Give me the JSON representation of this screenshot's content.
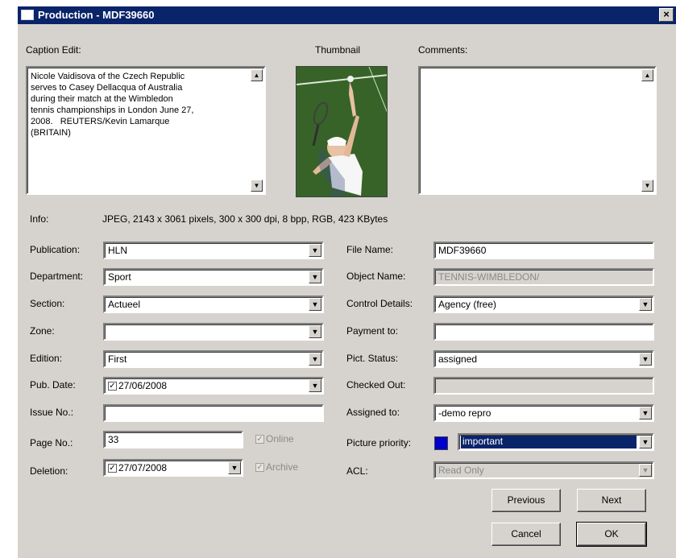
{
  "window": {
    "title": "Production - MDF39660",
    "close_glyph": "×"
  },
  "caption": {
    "label": "Caption Edit:",
    "text": "Nicole Vaidisova of the Czech Republic\nserves to Casey Dellacqua of Australia\nduring their match at the Wimbledon\ntennis championships in London June 27,\n2008.   REUTERS/Kevin Lamarque\n(BRITAIN)"
  },
  "thumbnail": {
    "label": "Thumbnail"
  },
  "comments": {
    "label": "Comments:",
    "text": ""
  },
  "info": {
    "label": "Info:",
    "value": "JPEG, 2143 x 3061 pixels, 300 x 300 dpi, 8 bpp, RGB, 423 KBytes"
  },
  "left_fields": {
    "publication": {
      "label": "Publication:",
      "value": "HLN"
    },
    "department": {
      "label": "Department:",
      "value": "Sport"
    },
    "section": {
      "label": "Section:",
      "value": "Actueel"
    },
    "zone": {
      "label": "Zone:",
      "value": ""
    },
    "edition": {
      "label": "Edition:",
      "value": "First"
    },
    "pub_date": {
      "label": "Pub. Date:",
      "value": "27/06/2008",
      "checked": "✓"
    },
    "issue_no": {
      "label": "Issue No.:",
      "value": ""
    },
    "page_no": {
      "label": "Page No.:",
      "value": "33"
    },
    "deletion": {
      "label": "Deletion:",
      "value": "27/07/2008",
      "checked": "✓"
    },
    "online": {
      "label": "Online",
      "checked": "✓"
    },
    "archive": {
      "label": "Archive",
      "checked": "✓"
    }
  },
  "right_fields": {
    "file_name": {
      "label": "File Name:",
      "value": "MDF39660"
    },
    "object_name": {
      "label": "Object Name:",
      "value": "TENNIS-WIMBLEDON/"
    },
    "control_details": {
      "label": "Control Details:",
      "value": "Agency (free)"
    },
    "payment_to": {
      "label": "Payment to:",
      "value": ""
    },
    "pict_status": {
      "label": "Pict. Status:",
      "value": "assigned"
    },
    "checked_out": {
      "label": "Checked Out:",
      "value": ""
    },
    "assigned_to": {
      "label": "Assigned to:",
      "value": "-demo repro"
    },
    "picture_priority": {
      "label": "Picture priority:",
      "value": "important",
      "color": "#0000cc"
    },
    "acl": {
      "label": "ACL:",
      "value": "Read Only"
    }
  },
  "buttons": {
    "previous": "Previous",
    "next": "Next",
    "cancel": "Cancel",
    "ok": "OK"
  },
  "glyphs": {
    "dropdown": "▼",
    "scroll_up": "▲",
    "scroll_down": "▼"
  }
}
